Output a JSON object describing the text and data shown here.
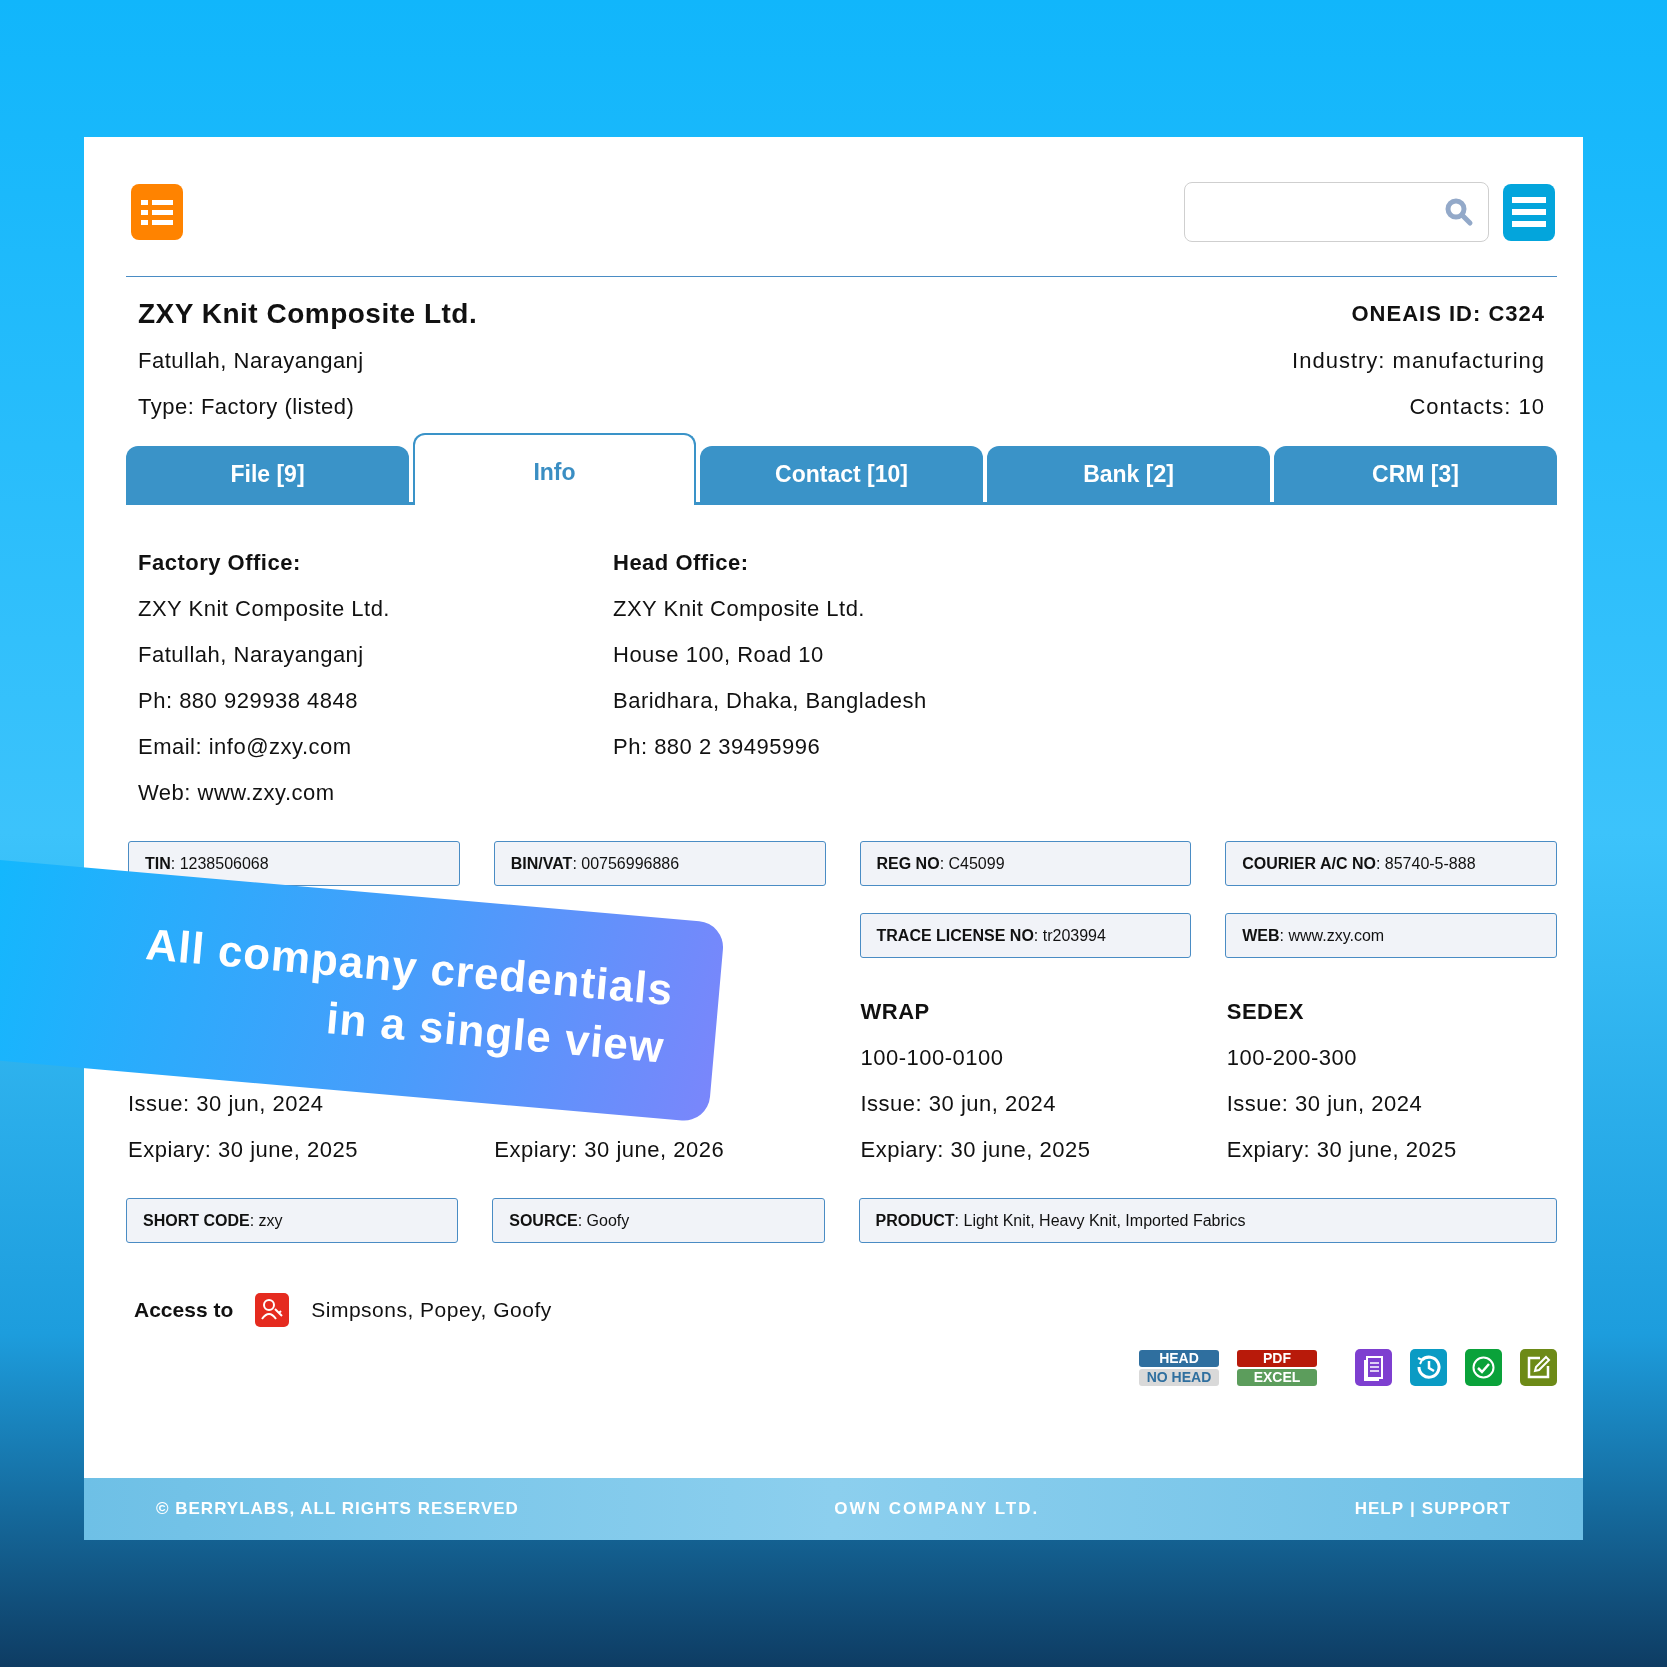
{
  "header": {
    "company": "ZXY Knit Composite Ltd.",
    "location": "Fatullah, Narayanganj",
    "type": "Type: Factory (listed)",
    "id": "ONEAIS ID: C324",
    "industry": "Industry: manufacturing",
    "contacts": "Contacts: 10"
  },
  "tabs": [
    {
      "label": "File [9]",
      "selected": false
    },
    {
      "label": "Info",
      "selected": true
    },
    {
      "label": "Contact [10]",
      "selected": false
    },
    {
      "label": "Bank [2]",
      "selected": false
    },
    {
      "label": "CRM [3]",
      "selected": false
    }
  ],
  "offices": [
    {
      "title": "Factory Office:",
      "lines": [
        "ZXY Knit Composite Ltd.",
        "Fatullah, Narayanganj",
        "Ph: 880 929938 4848",
        "Email: info@zxy.com",
        "Web: www.zxy.com"
      ]
    },
    {
      "title": "Head Office:",
      "lines": [
        "ZXY Knit Composite Ltd.",
        "House 100, Road 10",
        "Baridhara, Dhaka, Bangladesh",
        "Ph: 880 2 39495996"
      ]
    }
  ],
  "fields_row_1": [
    "**TIN**: 1238506068",
    "**BIN/VAT**: 00756996886",
    "**REG NO**: C45099",
    "**COURIER A/C NO**: 85740-5-888"
  ],
  "fields_row_2": [
    "**TRACE LICENSE NO**: tr203994",
    "**WEB**: www.zxy.com"
  ],
  "certificates": [
    {
      "issue": "Issue: 30 jun, 2024",
      "expiry": "Expiary: 30 june, 2025"
    },
    {
      "expiry": "Expiary: 30 june, 2026"
    },
    {
      "title": "WRAP",
      "number": "100-100-0100",
      "issue": "Issue: 30 jun, 2024",
      "expiry": "Expiary: 30 june, 2025"
    },
    {
      "title": "SEDEX",
      "number": "100-200-300",
      "issue": "Issue: 30 jun, 2024",
      "expiry": "Expiary: 30 june, 2025"
    }
  ],
  "fields_row_3": [
    "**SHORT CODE**: zxy",
    "**SOURCE**: Goofy",
    "**PRODUCT**: Light Knit, Heavy Knit, Imported Fabrics"
  ],
  "access": {
    "label": "Access to",
    "names": "Simpsons, Popey, Goofy"
  },
  "print_options": [
    {
      "label": "HEAD",
      "selected": true
    },
    {
      "label": "NO HEAD",
      "selected": false
    }
  ],
  "export_options": [
    {
      "label": "PDF",
      "kind": "pdf"
    },
    {
      "label": "EXCEL",
      "kind": "excel"
    }
  ],
  "banner": {
    "lines": [
      "All company credentials",
      "in a single view"
    ]
  },
  "footer": {
    "copyright": "© BERRYLABS, ALL RIGHTS RESERVED",
    "center": "OWN COMPANY LTD.",
    "links": [
      "HELP",
      "SUPPORT"
    ],
    "separator": "|"
  }
}
